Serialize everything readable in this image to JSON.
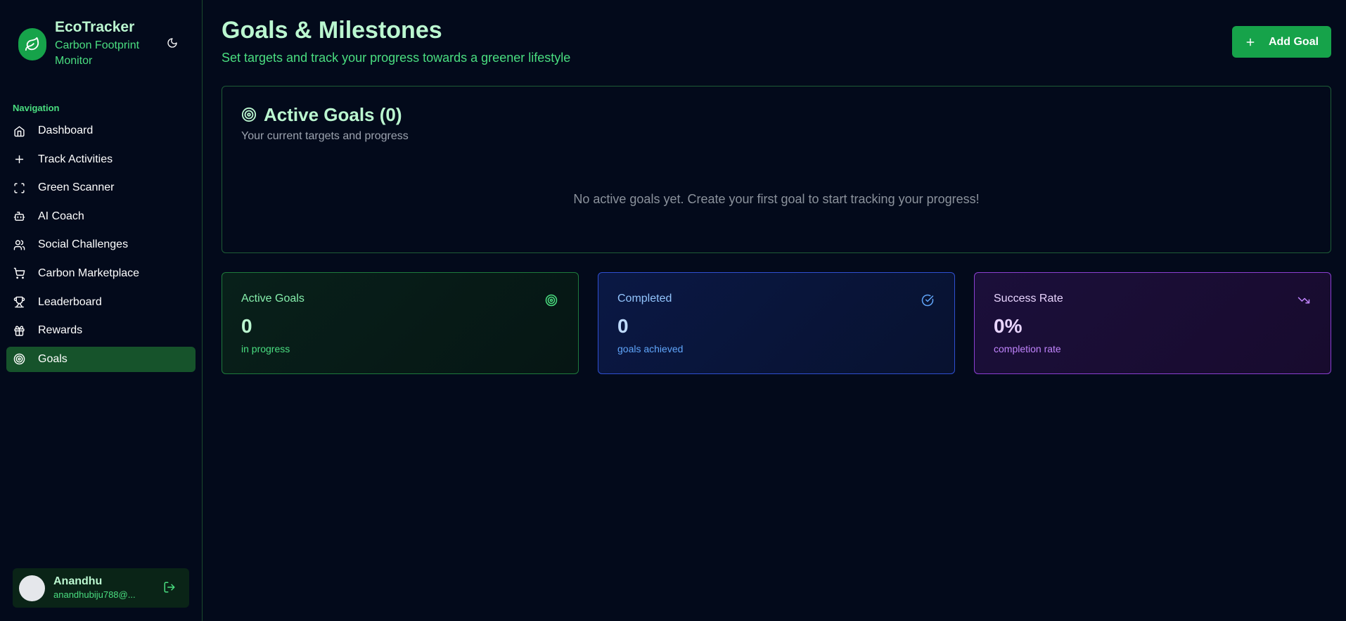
{
  "brand": {
    "title": "EcoTracker",
    "subtitle": "Carbon Footprint Monitor",
    "logo_icon": "leaf-icon",
    "theme_icon": "moon-icon"
  },
  "sidebar": {
    "section_label": "Navigation",
    "items": [
      {
        "label": "Dashboard",
        "icon": "home-icon"
      },
      {
        "label": "Track Activities",
        "icon": "plus-icon"
      },
      {
        "label": "Green Scanner",
        "icon": "scan-icon"
      },
      {
        "label": "AI Coach",
        "icon": "bot-icon"
      },
      {
        "label": "Social Challenges",
        "icon": "users-icon"
      },
      {
        "label": "Carbon Marketplace",
        "icon": "cart-icon"
      },
      {
        "label": "Leaderboard",
        "icon": "trophy-icon"
      },
      {
        "label": "Rewards",
        "icon": "gift-icon"
      },
      {
        "label": "Goals",
        "icon": "target-icon",
        "active": true
      }
    ],
    "user": {
      "name": "Anandhu",
      "email": "anandhubiju788@...",
      "logout_icon": "logout-icon"
    }
  },
  "header": {
    "title": "Goals & Milestones",
    "subtitle": "Set targets and track your progress towards a greener lifestyle",
    "add_button": "Add Goal"
  },
  "goals_panel": {
    "title": "Active Goals (0)",
    "subtitle": "Your current targets and progress",
    "empty_message": "No active goals yet. Create your first goal to start tracking your progress!"
  },
  "stats": {
    "active": {
      "label": "Active Goals",
      "value": "0",
      "caption": "in progress",
      "icon": "target-icon"
    },
    "completed": {
      "label": "Completed",
      "value": "0",
      "caption": "goals achieved",
      "icon": "check-circle-icon"
    },
    "success": {
      "label": "Success Rate",
      "value": "0%",
      "caption": "completion rate",
      "icon": "trending-down-icon"
    }
  },
  "colors": {
    "background": "#030a1b",
    "accent": "#16a34a",
    "active_nav": "#16532b"
  }
}
